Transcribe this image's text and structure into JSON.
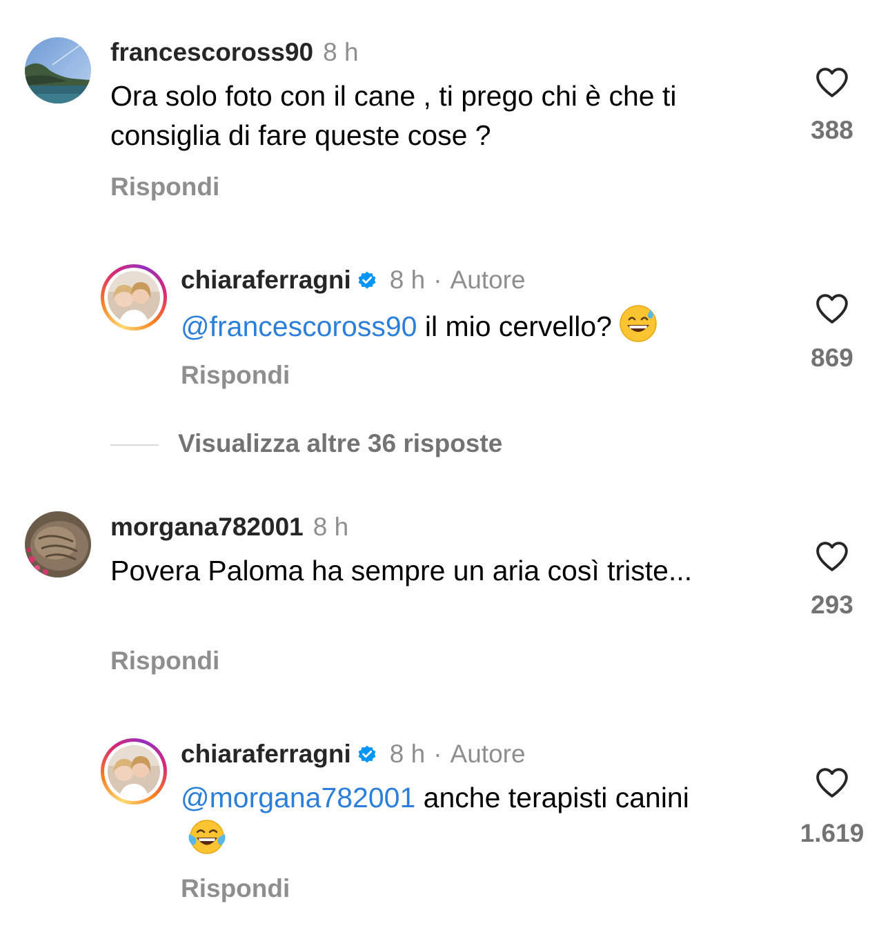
{
  "comments": [
    {
      "username": "francescoross90",
      "time": "8 h",
      "text": "Ora solo foto con il cane , ti prego chi è che ti consiglia di fare queste cose ?",
      "likes": "388",
      "reply_label": "Rispondi",
      "avatar_icon": "landscape-avatar"
    },
    {
      "username": "chiaraferragni",
      "time": "8 h",
      "separator": "·",
      "author_badge": "Autore",
      "mention": "@francescoross90",
      "text": "il mio cervello?",
      "emoji": "sweat-smile-emoji",
      "likes": "869",
      "reply_label": "Rispondi",
      "verified": true
    },
    {
      "username": "morgana782001",
      "time": "8 h",
      "text": "Povera Paloma ha sempre un aria così triste...",
      "likes": "293",
      "reply_label": "Rispondi",
      "avatar_icon": "cat-avatar"
    },
    {
      "username": "chiaraferragni",
      "time": "8 h",
      "separator": "·",
      "author_badge": "Autore",
      "mention": "@morgana782001",
      "text": "anche terapisti canini",
      "emoji": "tears-of-joy-emoji",
      "likes": "1.619",
      "reply_label": "Rispondi",
      "verified": true
    }
  ],
  "view_more_replies": "Visualizza altre 36 risposte",
  "colors": {
    "mention": "#2b7fd9",
    "secondary_text": "#8e8e8e",
    "verified": "#0095f6"
  }
}
